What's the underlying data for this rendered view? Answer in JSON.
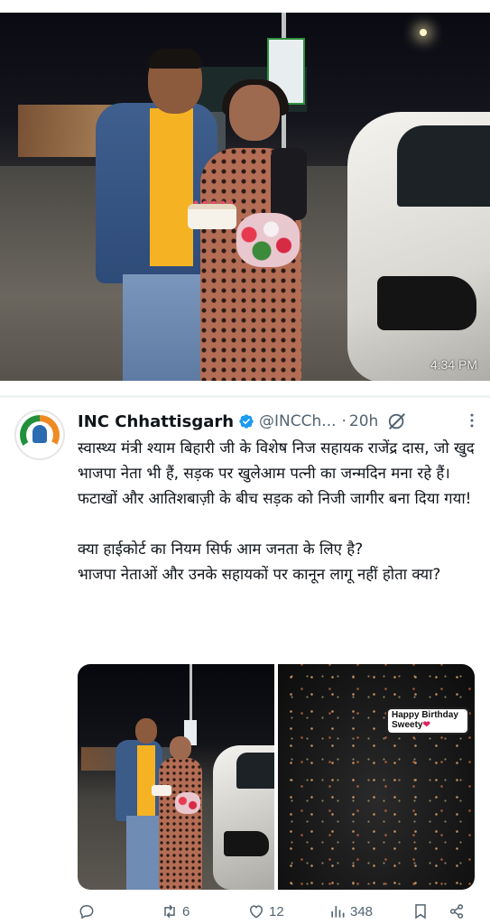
{
  "photo": {
    "timestamp": "4:34 PM"
  },
  "tweet": {
    "author_name": "INC Chhattisgarh",
    "handle": "@INCCh...",
    "separator": "·",
    "time": "20h",
    "text": "स्वास्थ्य मंत्री श्याम बिहारी जी के विशेष निज सहायक राजेंद्र दास, जो खुद भाजपा नेता भी हैं, सड़क पर खुलेआम पत्नी का जन्मदिन मना रहे हैं।\nफटाखों और आतिशबाज़ी के बीच सड़क को निजी जागीर बना दिया गया!\n\nक्या हाईकोर्ट का नियम सिर्फ आम जनता के लिए है?\nभाजपा नेताओं और उनके सहायकों पर कानून लागू नहीं होता क्या?",
    "media_sticker_line1": "Happy Birthday",
    "media_sticker_line2": "Sweety",
    "media_sticker_heart": "❤",
    "actions": {
      "reply_count": "",
      "retweet_count": "6",
      "like_count": "12",
      "views_count": "348"
    }
  },
  "colors": {
    "verified": "#1d9bf0",
    "muted": "#536471",
    "text": "#0f1419"
  },
  "icons": [
    "verified-badge-icon",
    "grok-icon",
    "more-icon",
    "reply-icon",
    "retweet-icon",
    "like-icon",
    "views-icon",
    "bookmark-icon",
    "share-icon"
  ]
}
